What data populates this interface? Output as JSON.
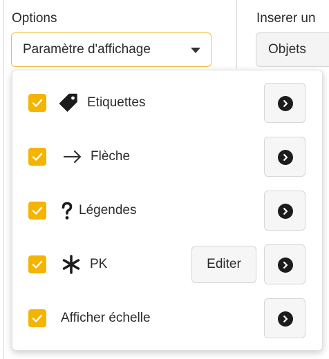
{
  "header": {
    "options_label": "Options",
    "insert_label": "Inserer un",
    "display_select": {
      "value": "Paramètre d'affichage",
      "icon": "chevron-down-icon"
    },
    "objects_button": "Objets"
  },
  "panel": {
    "items": [
      {
        "label": "Etiquettes",
        "checked": true,
        "icon": "tag-icon"
      },
      {
        "label": "Flèche",
        "checked": true,
        "icon": "arrow-right-icon"
      },
      {
        "label": "Légendes",
        "checked": true,
        "icon": "question-icon"
      },
      {
        "label": "PK",
        "checked": true,
        "icon": "asterisk-icon",
        "edit_label": "Editer"
      },
      {
        "label": "Afficher échelle",
        "checked": true,
        "icon": ""
      }
    ]
  },
  "colors": {
    "accent": "#f5b400",
    "select_border": "#f2bf3a",
    "button_bg": "#f6f6f6"
  }
}
